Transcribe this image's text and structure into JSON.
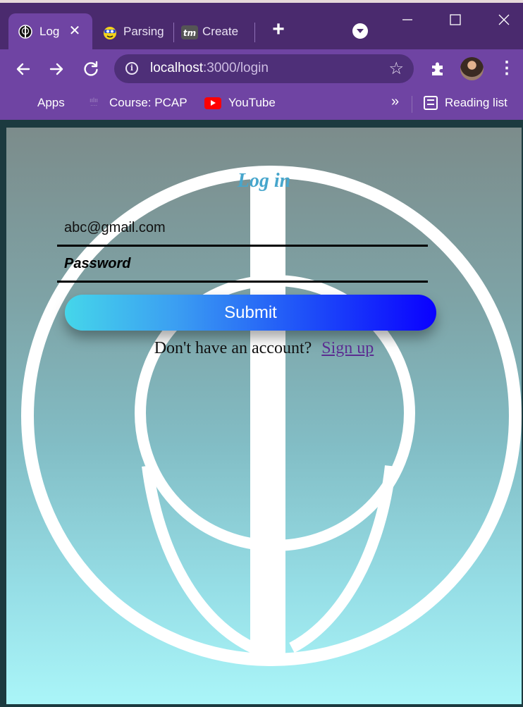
{
  "browser": {
    "tabs": [
      {
        "label": "Log",
        "active": true
      },
      {
        "label": "Parsing",
        "active": false
      },
      {
        "label": "Create",
        "active": false
      }
    ],
    "url_host": "localhost",
    "url_path": ":3000/login",
    "bookmarks": [
      {
        "label": "Apps"
      },
      {
        "label": "Course: PCAP"
      },
      {
        "label": "YouTube"
      }
    ],
    "bookmarks_overflow": "»",
    "reading_list": "Reading list"
  },
  "login": {
    "title": "Log in",
    "email_value": "abc@gmail.com",
    "password_placeholder": "Password",
    "submit_label": "Submit",
    "no_account_text": "Don't have an account?",
    "signup_link": "Sign up"
  },
  "colors": {
    "browser_frame": "#4a2a6e",
    "browser_toolbar": "#6f44a3",
    "title_color": "#47a6cc",
    "link_color": "#5b2d91"
  }
}
